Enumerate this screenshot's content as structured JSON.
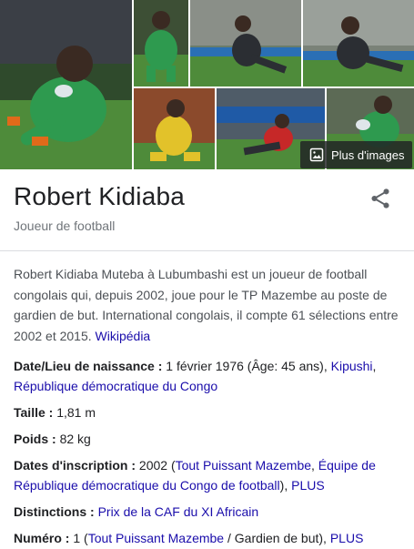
{
  "gallery": {
    "more_images_label": "Plus d'images"
  },
  "entity": {
    "name": "Robert Kidiaba",
    "subtitle": "Joueur de football"
  },
  "description": {
    "text": "Robert Kidiaba Muteba à Lubumbashi est un joueur de football congolais qui, depuis 2002, joue pour le TP Mazembe au poste de gardien de but. International congolais, il compte 61 sélections entre 2002 et 2015.",
    "source_link": "Wikipédia"
  },
  "facts": {
    "birth": {
      "label": "Date/Lieu de naissance :",
      "value": "1 février 1976 (Âge: 45 ans),",
      "link1": "Kipushi",
      "sep": ",",
      "link2": "République démocratique du Congo"
    },
    "height": {
      "label": "Taille :",
      "value": "1,81 m"
    },
    "weight": {
      "label": "Poids :",
      "value": "82 kg"
    },
    "teams": {
      "label": "Dates d'inscription :",
      "value": "2002 (",
      "link1": "Tout Puissant Mazembe",
      "sep": ",",
      "link2": "Équipe de République démocratique du Congo de football",
      "close": "),",
      "more": "PLUS"
    },
    "awards": {
      "label": "Distinctions :",
      "link": "Prix de la CAF du XI Africain"
    },
    "number": {
      "label": "Numéro :",
      "value": "1 (",
      "link1": "Tout Puissant Mazembe",
      "mid": "/ Gardien de but),",
      "more": "PLUS"
    }
  },
  "colors": {
    "link": "#1a0dab",
    "pitch": "#4e8b3a",
    "jersey_green": "#2e9a4f",
    "jersey_yellow": "#e2c22a"
  },
  "icons": [
    "image-icon",
    "share-icon"
  ]
}
